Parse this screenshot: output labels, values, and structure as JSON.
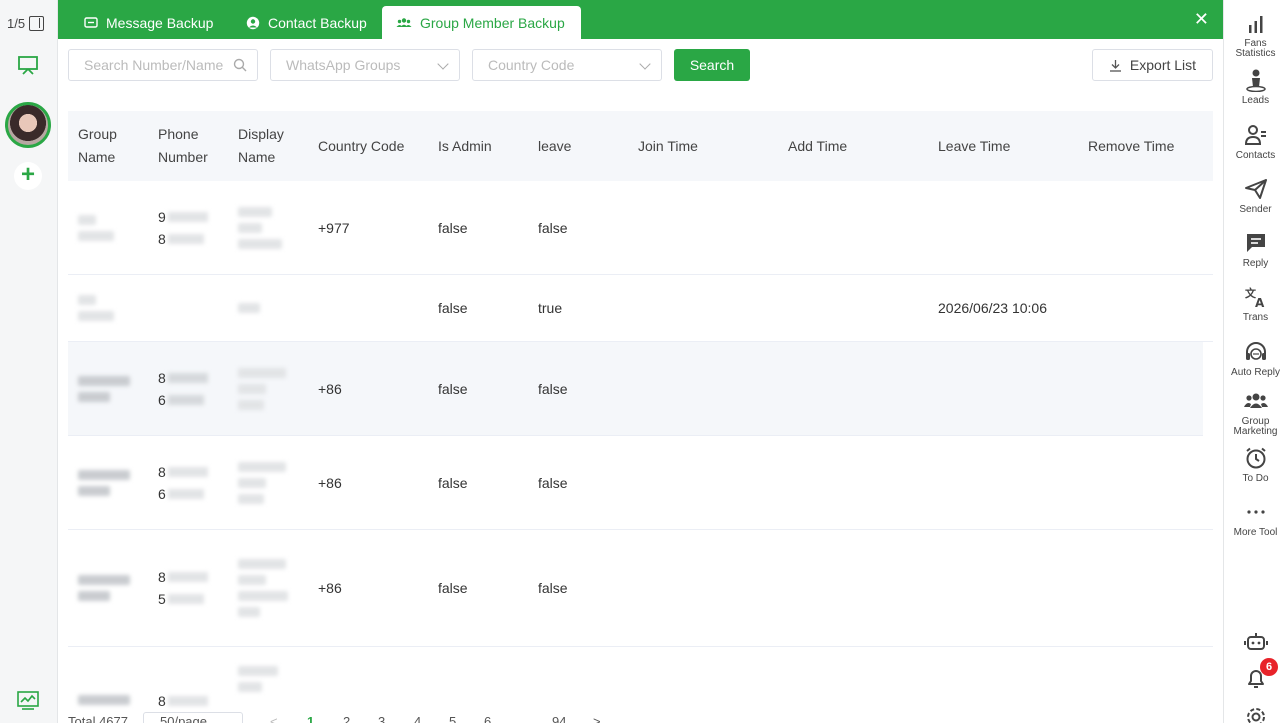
{
  "left_rail": {
    "counter": "1/5"
  },
  "tabs": [
    {
      "label": "Message Backup",
      "active": false
    },
    {
      "label": "Contact Backup",
      "active": false
    },
    {
      "label": "Group Member Backup",
      "active": true
    }
  ],
  "toolbar": {
    "search_placeholder": "Search Number/Name",
    "groups_placeholder": "WhatsApp Groups",
    "country_placeholder": "Country Code",
    "search_label": "Search",
    "export_label": "Export List"
  },
  "table": {
    "headers": {
      "group_name_1": "Group",
      "group_name_2": "Name",
      "phone_1": "Phone",
      "phone_2": "Number",
      "display_1": "Display",
      "display_2": "Name",
      "country_code": "Country Code",
      "is_admin": "Is Admin",
      "leave": "leave",
      "join_time": "Join Time",
      "add_time": "Add Time",
      "leave_time": "Leave Time",
      "remove_time": "Remove Time"
    },
    "rows": [
      {
        "phone_a": "9",
        "phone_b": "8",
        "country_code": "+977",
        "is_admin": "false",
        "leave": "false",
        "leave_time": ""
      },
      {
        "phone_a": "",
        "phone_b": "",
        "country_code": "",
        "is_admin": "false",
        "leave": "true",
        "leave_time": "2026/06/23 10:06"
      },
      {
        "phone_a": "8",
        "phone_b": "6",
        "country_code": "+86",
        "is_admin": "false",
        "leave": "false",
        "leave_time": ""
      },
      {
        "phone_a": "8",
        "phone_b": "6",
        "country_code": "+86",
        "is_admin": "false",
        "leave": "false",
        "leave_time": ""
      },
      {
        "phone_a": "8",
        "phone_b": "5",
        "country_code": "+86",
        "is_admin": "false",
        "leave": "false",
        "leave_time": ""
      },
      {
        "phone_a": "8",
        "phone_b": "",
        "country_code": "",
        "is_admin": "",
        "leave": "",
        "leave_time": ""
      }
    ]
  },
  "pagination": {
    "total": "Total 4677",
    "page_size": "50/page",
    "prev": "<",
    "pages": [
      "1",
      "2",
      "3",
      "4",
      "5",
      "6"
    ],
    "ellipsis": "...",
    "last": "94",
    "next": ">"
  },
  "right_rail": {
    "items": [
      {
        "label1": "Fans",
        "label2": "Statistics",
        "icon": "bar-chart-icon"
      },
      {
        "label1": "Leads",
        "label2": "",
        "icon": "person-icon"
      },
      {
        "label1": "Contacts",
        "label2": "",
        "icon": "contacts-icon"
      },
      {
        "label1": "Sender",
        "label2": "",
        "icon": "paper-plane-icon"
      },
      {
        "label1": "Reply",
        "label2": "",
        "icon": "chat-icon"
      },
      {
        "label1": "Trans",
        "label2": "",
        "icon": "translate-icon"
      },
      {
        "label1": "Auto Reply",
        "label2": "",
        "icon": "headset-icon"
      },
      {
        "label1": "Group",
        "label2": "Marketing",
        "icon": "group-icon"
      },
      {
        "label1": "To Do",
        "label2": "",
        "icon": "alarm-icon"
      },
      {
        "label1": "More Tool",
        "label2": "",
        "icon": "more-icon"
      }
    ],
    "notification_count": "6"
  },
  "colors": {
    "brand": "#2aa745",
    "badge": "#e8232a"
  }
}
